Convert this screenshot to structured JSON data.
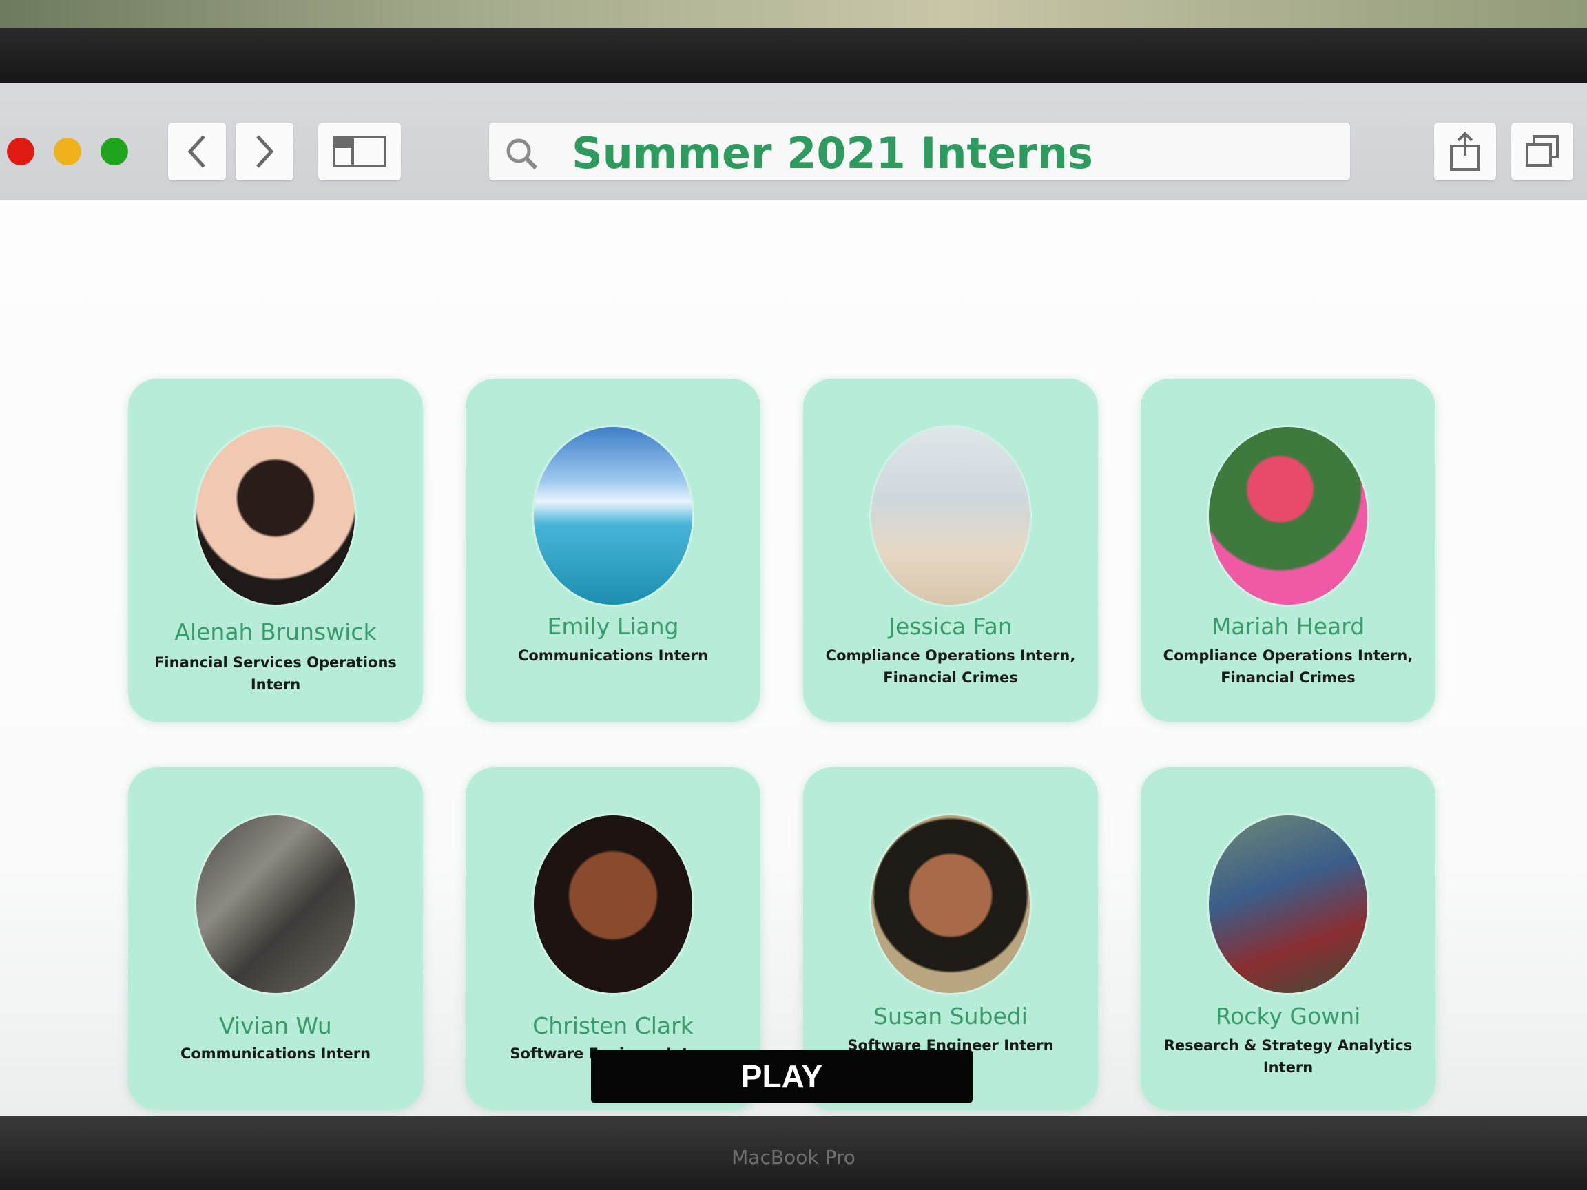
{
  "browser": {
    "title": "Summer 2021 Interns",
    "device_label": "MacBook Pro"
  },
  "interns": [
    {
      "name": "Alenah Brunswick",
      "role": "Financial Services Operations Intern"
    },
    {
      "name": "Emily Liang",
      "role": "Communications Intern"
    },
    {
      "name": "Jessica Fan",
      "role": "Compliance Operations Intern, Financial Crimes"
    },
    {
      "name": "Mariah Heard",
      "role": "Compliance Operations Intern, Financial Crimes"
    },
    {
      "name": "Vivian Wu",
      "role": "Communications Intern"
    },
    {
      "name": "Christen Clark",
      "role": "Software Engineer Intern"
    },
    {
      "name": "Susan Subedi",
      "role": "Software Engineer Intern"
    },
    {
      "name": "Rocky Gowni",
      "role": "Research & Strategy Analytics Intern"
    }
  ],
  "play_button": {
    "label": "PLAY"
  },
  "colors": {
    "title_green": "#2e9b5e",
    "card_mint": "#b6ecd8",
    "name_green": "#3a9b6b",
    "traffic_red": "#e01b14",
    "traffic_yellow": "#f0b21a",
    "traffic_green": "#1fa51d"
  },
  "icons": [
    "back-arrow-icon",
    "forward-arrow-icon",
    "sidebar-icon",
    "search-icon",
    "share-icon",
    "tabs-icon"
  ]
}
